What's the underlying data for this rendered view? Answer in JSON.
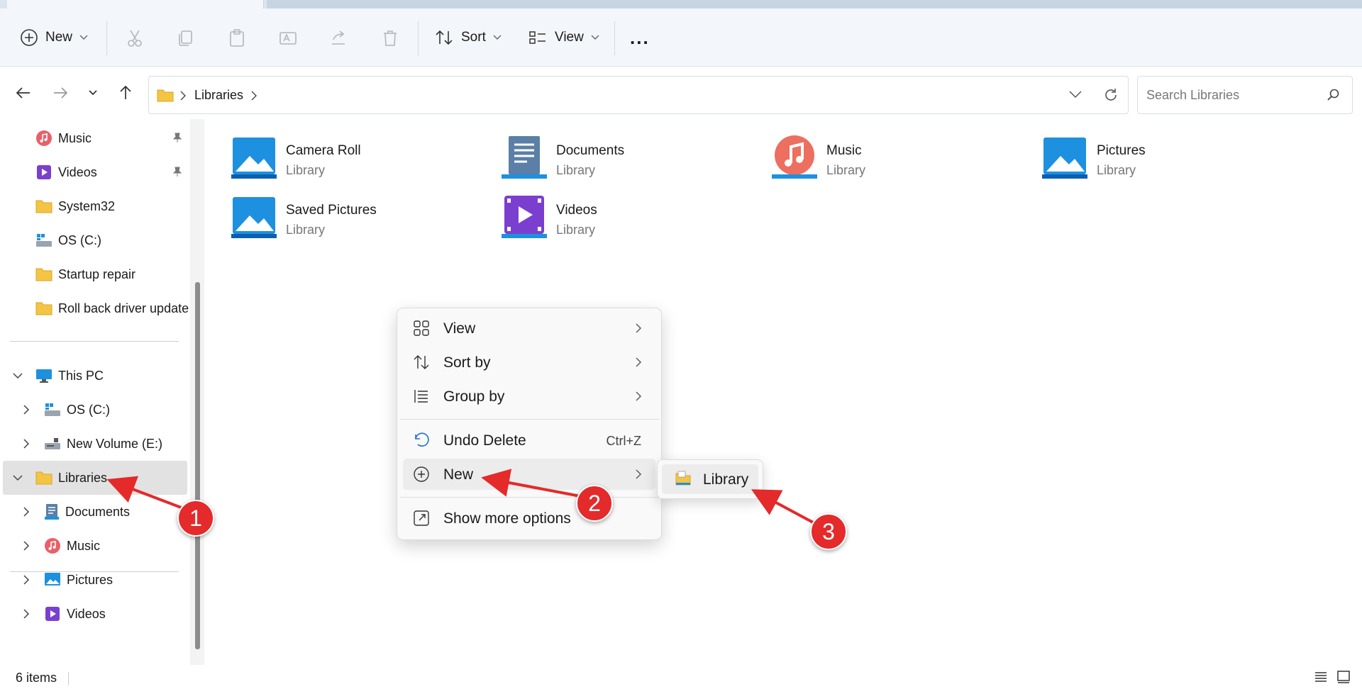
{
  "toolbar": {
    "new_label": "New",
    "sort_label": "Sort",
    "view_label": "View",
    "more_label": "..."
  },
  "address": {
    "segment": "Libraries",
    "search_placeholder": "Search Libraries"
  },
  "sidebar": {
    "quick_access": [
      {
        "label": "Music",
        "icon": "music-icon",
        "pinned": true
      },
      {
        "label": "Videos",
        "icon": "videos-icon",
        "pinned": true
      },
      {
        "label": "System32",
        "icon": "folder-icon",
        "pinned": false
      },
      {
        "label": "OS (C:)",
        "icon": "drive-icon",
        "pinned": false
      },
      {
        "label": "Startup repair",
        "icon": "folder-icon",
        "pinned": false
      },
      {
        "label": "Roll back driver update",
        "icon": "folder-icon",
        "pinned": false
      }
    ],
    "this_pc": {
      "label": "This PC",
      "children": [
        "OS (C:)",
        "New Volume (E:)"
      ]
    },
    "libraries": {
      "label": "Libraries",
      "children": [
        "Documents",
        "Music"
      ]
    },
    "extra": [
      "Pictures",
      "Videos"
    ]
  },
  "libraries": [
    {
      "name": "Camera Roll",
      "type": "Library",
      "icon": "pictures-library-icon"
    },
    {
      "name": "Documents",
      "type": "Library",
      "icon": "documents-library-icon"
    },
    {
      "name": "Music",
      "type": "Library",
      "icon": "music-library-icon"
    },
    {
      "name": "Pictures",
      "type": "Library",
      "icon": "pictures-library-icon"
    },
    {
      "name": "Saved Pictures",
      "type": "Library",
      "icon": "pictures-library-icon"
    },
    {
      "name": "Videos",
      "type": "Library",
      "icon": "videos-library-icon"
    }
  ],
  "context_menu": {
    "view": "View",
    "sort_by": "Sort by",
    "group_by": "Group by",
    "undo_delete": "Undo Delete",
    "undo_shortcut": "Ctrl+Z",
    "new": "New",
    "show_more": "Show more options"
  },
  "submenu": {
    "library": "Library"
  },
  "status": {
    "item_count": "6 items"
  },
  "callouts": [
    "1",
    "2",
    "3"
  ],
  "colors": {
    "accent": "#0067c0",
    "callout": "#e42a2a",
    "folder": "#f4c545"
  }
}
